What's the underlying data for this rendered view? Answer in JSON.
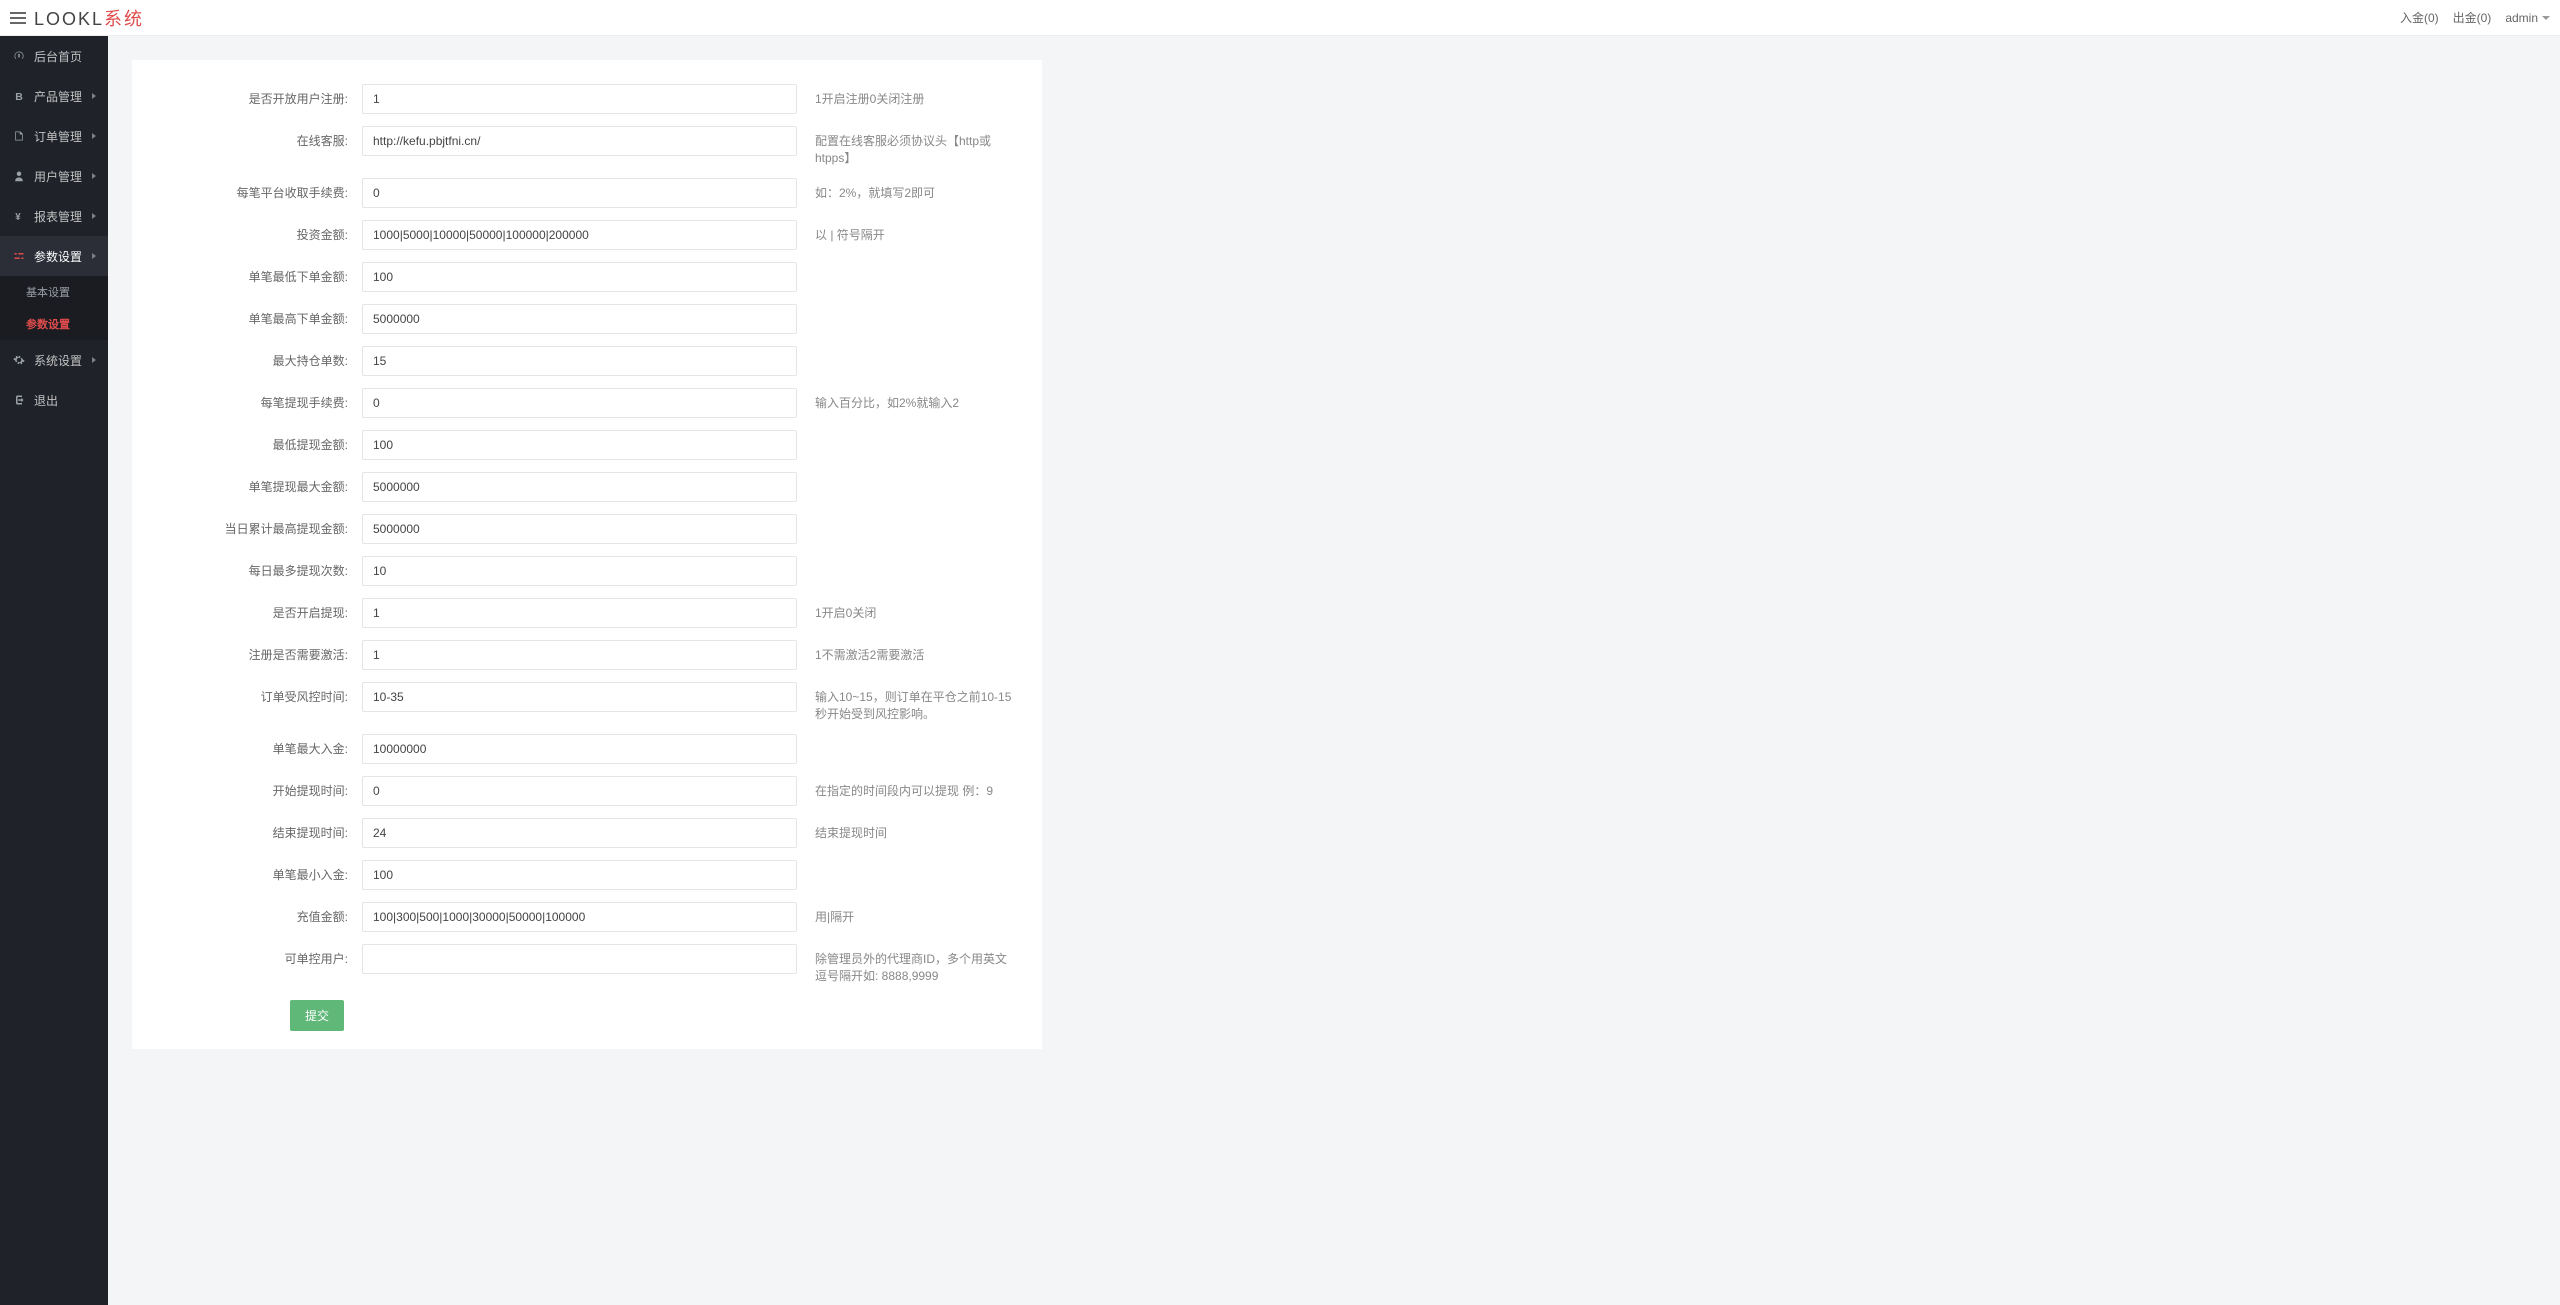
{
  "brand": {
    "prefix": "LOOKL",
    "suffix": "系统"
  },
  "header": {
    "deposit": "入金(0)",
    "withdraw": "出金(0)",
    "user": "admin"
  },
  "sidebar": {
    "items": [
      {
        "icon": "dashboard",
        "label": "后台首页",
        "arrow": false
      },
      {
        "icon": "bitcoin",
        "label": "产品管理",
        "arrow": true
      },
      {
        "icon": "order",
        "label": "订单管理",
        "arrow": true
      },
      {
        "icon": "user",
        "label": "用户管理",
        "arrow": true
      },
      {
        "icon": "yen",
        "label": "报表管理",
        "arrow": true
      },
      {
        "icon": "params",
        "label": "参数设置",
        "arrow": true,
        "active": true,
        "sub": [
          {
            "label": "基本设置",
            "active": false
          },
          {
            "label": "参数设置",
            "active": true
          }
        ]
      },
      {
        "icon": "system",
        "label": "系统设置",
        "arrow": true
      },
      {
        "icon": "logout",
        "label": "退出",
        "arrow": false
      }
    ]
  },
  "form": {
    "rows": [
      {
        "label": "是否开放用户注册:",
        "value": "1",
        "hint": "1开启注册0关闭注册"
      },
      {
        "label": "在线客服:",
        "value": "http://kefu.pbjtfni.cn/",
        "hint": "配置在线客服必须协议头【http或htpps】"
      },
      {
        "label": "每笔平台收取手续费:",
        "value": "0",
        "hint": "如：2%，就填写2即可"
      },
      {
        "label": "投资金额:",
        "value": "1000|5000|10000|50000|100000|200000",
        "hint": "以 | 符号隔开"
      },
      {
        "label": "单笔最低下单金额:",
        "value": "100",
        "hint": ""
      },
      {
        "label": "单笔最高下单金额:",
        "value": "5000000",
        "hint": ""
      },
      {
        "label": "最大持仓单数:",
        "value": "15",
        "hint": ""
      },
      {
        "label": "每笔提现手续费:",
        "value": "0",
        "hint": "输入百分比，如2%就输入2"
      },
      {
        "label": "最低提现金额:",
        "value": "100",
        "hint": ""
      },
      {
        "label": "单笔提现最大金额:",
        "value": "5000000",
        "hint": ""
      },
      {
        "label": "当日累计最高提现金额:",
        "value": "5000000",
        "hint": ""
      },
      {
        "label": "每日最多提现次数:",
        "value": "10",
        "hint": ""
      },
      {
        "label": "是否开启提现:",
        "value": "1",
        "hint": "1开启0关闭"
      },
      {
        "label": "注册是否需要激活:",
        "value": "1",
        "hint": "1不需激活2需要激活"
      },
      {
        "label": "订单受风控时间:",
        "value": "10-35",
        "hint": "输入10~15，则订单在平仓之前10-15秒开始受到风控影响。"
      },
      {
        "label": "单笔最大入金:",
        "value": "10000000",
        "hint": ""
      },
      {
        "label": "开始提现时间:",
        "value": "0",
        "hint": "在指定的时间段内可以提现 例：9"
      },
      {
        "label": "结束提现时间:",
        "value": "24",
        "hint": "结束提现时间"
      },
      {
        "label": "单笔最小入金:",
        "value": "100",
        "hint": ""
      },
      {
        "label": "充值金额:",
        "value": "100|300|500|1000|30000|50000|100000",
        "hint": "用|隔开"
      },
      {
        "label": "可单控用户:",
        "value": "",
        "hint": "除管理员外的代理商ID，多个用英文逗号隔开如: 8888,9999"
      }
    ],
    "submit": "提交"
  }
}
